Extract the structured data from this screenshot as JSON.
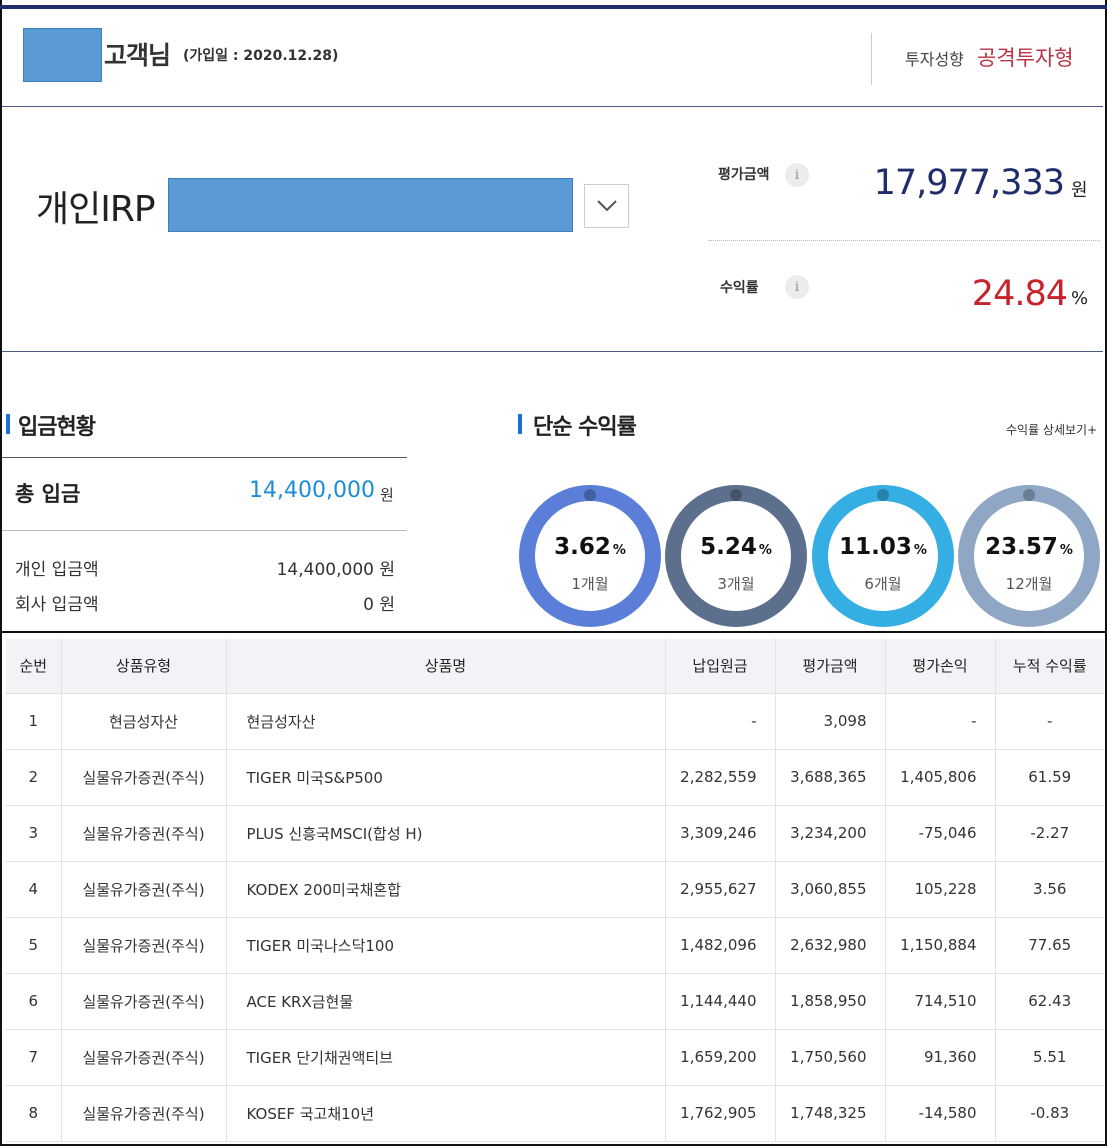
{
  "customer": {
    "name_suffix": "고객님",
    "join_date": "(가입일 : 2020.12.28)",
    "invest_label": "투자성향",
    "invest_type": "공격투자형"
  },
  "account": {
    "title": "개인IRP",
    "eval_label": "평가금액",
    "eval_value": "17,977,333",
    "eval_unit": "원",
    "return_label": "수익률",
    "return_value": "24.84",
    "return_unit": "%",
    "info_icon": "i"
  },
  "deposit": {
    "title": "입금현황",
    "total_label": "총 입금",
    "total_value": "14,400,000",
    "total_unit": "원",
    "rows": [
      {
        "label": "개인 입금액",
        "value": "14,400,000 원"
      },
      {
        "label": "회사 입금액",
        "value": "0 원"
      }
    ]
  },
  "simple_return": {
    "title": "단순 수익률",
    "detail_link": "수익률 상세보기+",
    "items": [
      {
        "value": "3.62",
        "unit": "%",
        "period": "1개월",
        "color": "#5b7fd8"
      },
      {
        "value": "5.24",
        "unit": "%",
        "period": "3개월",
        "color": "#5c6f8d"
      },
      {
        "value": "11.03",
        "unit": "%",
        "period": "6개월",
        "color": "#35aee3"
      },
      {
        "value": "23.57",
        "unit": "%",
        "period": "12개월",
        "color": "#8fa7c5"
      }
    ]
  },
  "holdings": {
    "headers": [
      "순번",
      "상품유형",
      "상품명",
      "납입원금",
      "평가금액",
      "평가손익",
      "누적 수익률"
    ],
    "rows": [
      [
        "1",
        "현금성자산",
        "현금성자산",
        "-",
        "3,098",
        "-",
        "-"
      ],
      [
        "2",
        "실물유가증권(주식)",
        "TIGER 미국S&P500",
        "2,282,559",
        "3,688,365",
        "1,405,806",
        "61.59"
      ],
      [
        "3",
        "실물유가증권(주식)",
        "PLUS 신흥국MSCI(합성 H)",
        "3,309,246",
        "3,234,200",
        "-75,046",
        "-2.27"
      ],
      [
        "4",
        "실물유가증권(주식)",
        "KODEX 200미국채혼합",
        "2,955,627",
        "3,060,855",
        "105,228",
        "3.56"
      ],
      [
        "5",
        "실물유가증권(주식)",
        "TIGER 미국나스닥100",
        "1,482,096",
        "2,632,980",
        "1,150,884",
        "77.65"
      ],
      [
        "6",
        "실물유가증권(주식)",
        "ACE KRX금현물",
        "1,144,440",
        "1,858,950",
        "714,510",
        "62.43"
      ],
      [
        "7",
        "실물유가증권(주식)",
        "TIGER 단기채권액티브",
        "1,659,200",
        "1,750,560",
        "91,360",
        "5.51"
      ],
      [
        "8",
        "실물유가증권(주식)",
        "KOSEF 국고채10년",
        "1,762,905",
        "1,748,325",
        "-14,580",
        "-0.83"
      ]
    ]
  }
}
